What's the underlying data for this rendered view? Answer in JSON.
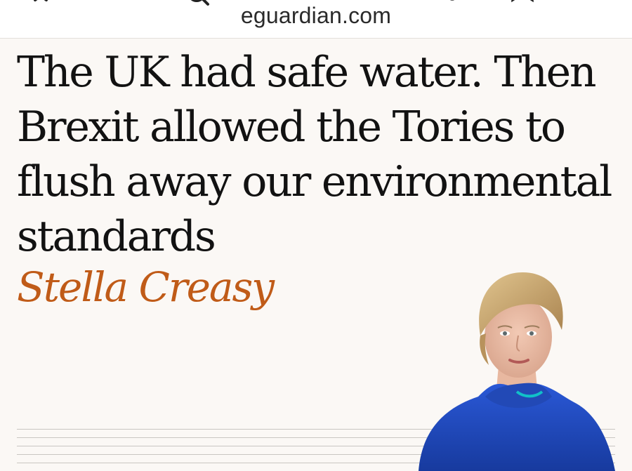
{
  "browser": {
    "url": "eguardian.com",
    "icons": [
      "close-icon",
      "search-icon",
      "share-icon",
      "bookmark-icon",
      "more-icon"
    ]
  },
  "article": {
    "headline": "The UK had safe water. Then Brexit allowed the Tories to flush away our environmental standards",
    "author": "Stella Creasy"
  },
  "colors": {
    "page_background": "#fbf8f5",
    "headline_text": "#121212",
    "author_accent": "#c05b18",
    "portrait_top": "#1f46b8"
  }
}
